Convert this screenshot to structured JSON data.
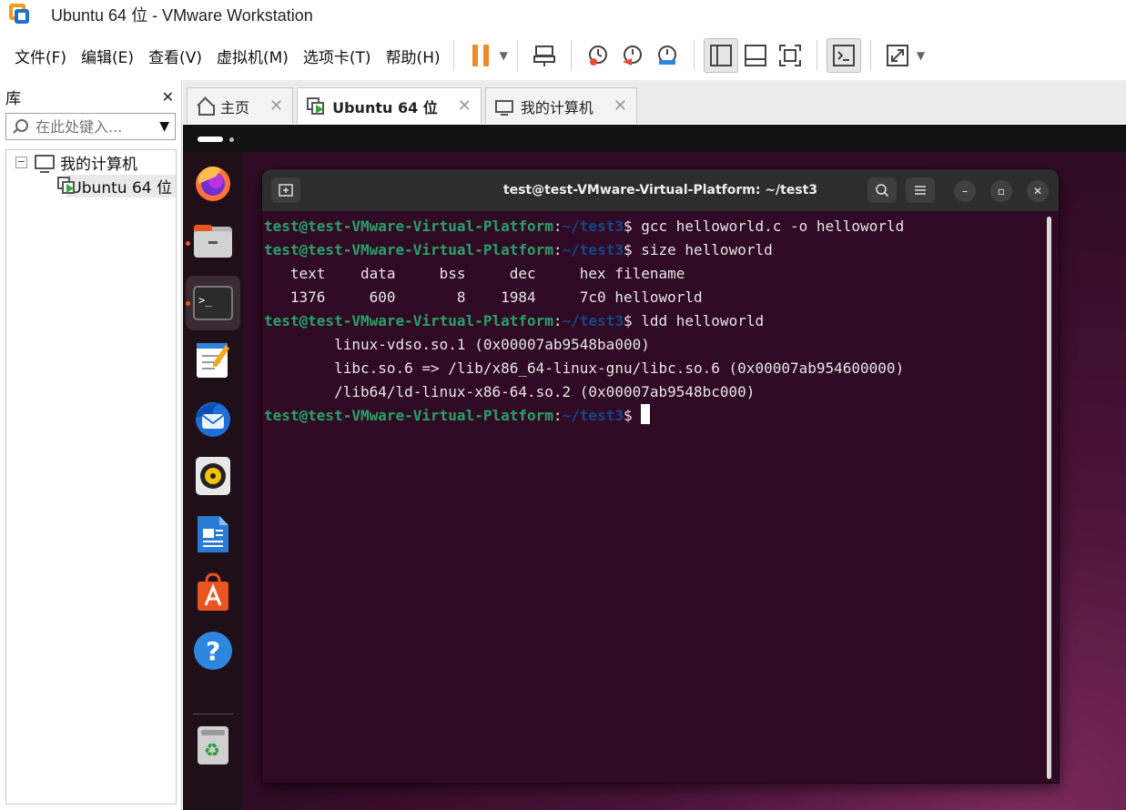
{
  "window": {
    "title": "Ubuntu 64 位 - VMware Workstation"
  },
  "menu": {
    "items": [
      "文件(F)",
      "编辑(E)",
      "查看(V)",
      "虚拟机(M)",
      "选项卡(T)",
      "帮助(H)"
    ]
  },
  "library": {
    "title": "库",
    "search_placeholder": "在此处键入...",
    "tree": [
      {
        "label": "我的计算机",
        "toggle": "−"
      },
      {
        "label": "Ubuntu 64 位"
      }
    ]
  },
  "tabs": [
    {
      "label": "主页"
    },
    {
      "label": "Ubuntu 64 位"
    },
    {
      "label": "我的计算机"
    }
  ],
  "terminal": {
    "title": "test@test-VMware-Virtual-Platform: ~/test3",
    "prompt_user": "test@test-VMware-Virtual-Platform",
    "prompt_sep": ":",
    "prompt_path": "~/test3",
    "prompt_end": "$ ",
    "lines": [
      {
        "type": "prompt",
        "cmd": "gcc helloworld.c -o helloworld"
      },
      {
        "type": "prompt",
        "cmd": "size helloworld"
      },
      {
        "type": "out",
        "text": "   text    data     bss     dec     hex filename"
      },
      {
        "type": "out",
        "text": "   1376     600       8    1984     7c0 helloworld"
      },
      {
        "type": "prompt",
        "cmd": "ldd helloworld"
      },
      {
        "type": "out",
        "text": "        linux-vdso.so.1 (0x00007ab9548ba000)"
      },
      {
        "type": "out",
        "text": "        libc.so.6 => /lib/x86_64-linux-gnu/libc.so.6 (0x00007ab954600000)"
      },
      {
        "type": "out",
        "text": "        /lib64/ld-linux-x86-64.so.2 (0x00007ab9548bc000)"
      },
      {
        "type": "prompt",
        "cmd": ""
      }
    ]
  },
  "dock": {
    "apps": [
      "firefox-icon",
      "files-icon",
      "terminal-icon",
      "text-editor-icon",
      "thunderbird-icon",
      "rhythmbox-icon",
      "writer-icon",
      "app-center-icon",
      "help-icon",
      "trash-icon"
    ]
  },
  "colors": {
    "terminal_bg": "#300a24",
    "prompt_user": "#26a269",
    "prompt_path": "#12488b",
    "pause_accent": "#f08a24"
  }
}
